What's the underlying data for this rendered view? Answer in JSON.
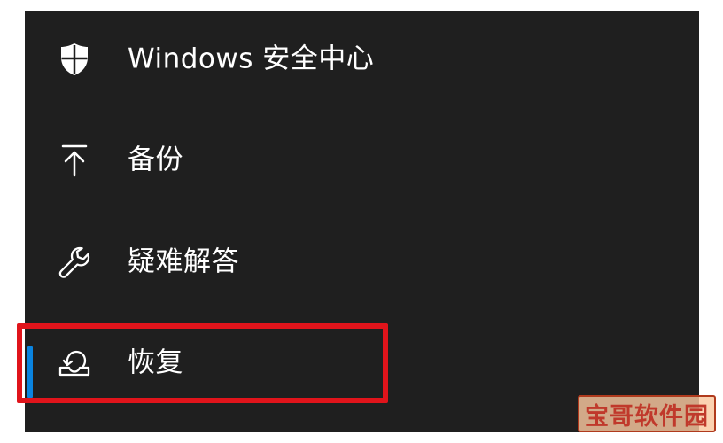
{
  "menu": {
    "items": [
      {
        "label": "Windows 安全中心",
        "icon": "shield-icon"
      },
      {
        "label": "备份",
        "icon": "upload-arrow-icon"
      },
      {
        "label": "疑难解答",
        "icon": "wrench-icon"
      },
      {
        "label": "恢复",
        "icon": "recovery-icon",
        "selected": true
      }
    ]
  },
  "colors": {
    "background": "#1f1f1f",
    "text": "#ffffff",
    "selection_accent": "#0a84e0",
    "highlight_box": "#e0141b"
  },
  "watermark": {
    "text": "宝哥软件园"
  }
}
